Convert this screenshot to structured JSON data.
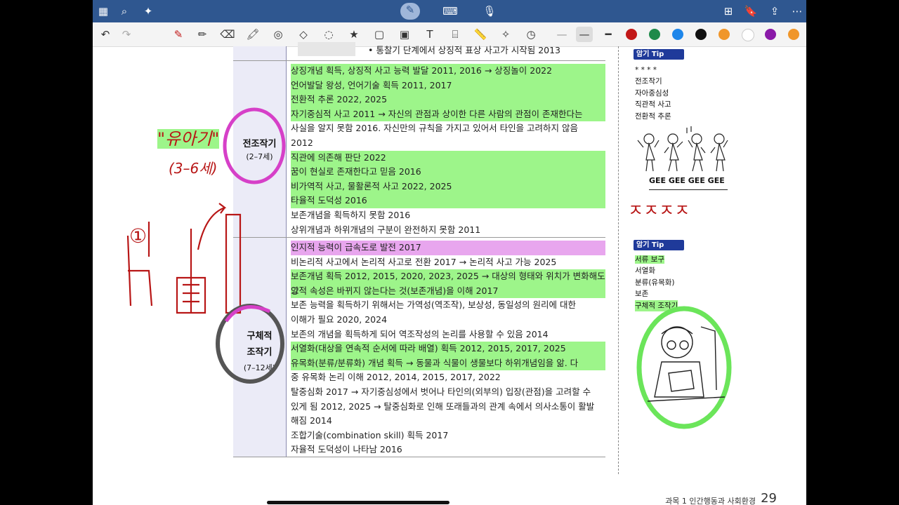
{
  "toolbar_colors": [
    "#c21818",
    "#1e8a4a",
    "#1e86ea",
    "#111111",
    "#f0962a",
    "#ffffff",
    "#8a1aa8",
    "#f0962a"
  ],
  "top": {
    "partial_line": "• 통찰기 단계에서 상징적 표상 사고가 시작됨 2013"
  },
  "stages": {
    "s1": {
      "name": "전조작기",
      "age": "(2–7세)"
    },
    "s2": {
      "name1": "구체적",
      "name2": "조작기",
      "age": "(7–12세)"
    }
  },
  "items1": [
    "상징개념 획득, 상징적 사고 능력 발달 2011, 2016 → 상징놀이 2022",
    "언어발달 왕성, 언어기술 획득 2011, 2017",
    "전환적 추론 2022, 2025",
    "자기중심적 사고 2011 → 자신의 관점과 상이한 다른 사람의 관점이 존재한다는",
    "사실을 알지 못함 2016. 자신만의 규칙을 가지고 있어서 타인을 고려하지 않음",
    "2012",
    "직관에 의존해 판단 2022",
    "꿈이 현실로 존재한다고 믿음 2016",
    "비가역적 사고, 물활론적 사고 2022, 2025",
    "타율적 도덕성 2016",
    "보존개념을 획득하지 못함 2016",
    "상위개념과 하위개념의 구분이 완전하지 못함 2011"
  ],
  "items2": [
    "인지적 능력이 급속도로 발전 2017",
    "비논리적 사고에서 논리적 사고로 전환 2017 → 논리적 사고 가능 2025",
    "보존개념 획득 2012, 2015, 2020, 2023, 2025 → 대상의 형태와 위치가 변화해도 그",
    "양적 속성은 바뀌지 않는다는 것(보존개념)을 이해 2017",
    "보존 능력을 획득하기 위해서는 가역성(역조작), 보상성, 동일성의 원리에 대한",
    "이해가 필요 2020, 2024",
    "보존의 개념을 획득하게 되어 역조작성의 논리를 사용할 수 있음 2014",
    "서열화(대상을 연속적 순서에 따라 배열) 획득 2012, 2015, 2017, 2025",
    "유목화(분류/분류화) 개념 획득 → 동물과 식물이 생물보다 하위개념임을 앎. 다",
    "중 유목화 논리 이해 2012, 2014, 2015, 2017, 2022",
    "탈중심화 2017 → 자기중심성에서 벗어나 타인의(외부의) 입장(관점)을 고려할 수",
    "있게 됨 2012, 2025 → 탈중심화로 인해 또래들과의 관계 속에서 의사소통이 활발",
    "해짐 2014",
    "조합기술(combination skill) 획득 2017",
    "자율적 도덕성이 나타남 2016"
  ],
  "tip1": {
    "label": "암기 Tip",
    "stars": "* * * *",
    "lines": [
      "전조작기",
      "자아중심성",
      "직관적 사고",
      "전환적 추론"
    ],
    "caption": "GEE GEE GEE GEE"
  },
  "tip2": {
    "label": "암기 Tip",
    "head": "서류 보구",
    "lines": [
      "서열화",
      "분류(유목화)",
      "보존",
      "구체적 조작기"
    ]
  },
  "handwriting": {
    "yuagi": "\"유아기\"",
    "age": "(3–6세)",
    "marks": "ㅈㅈㅈㅈ",
    "num": "①"
  },
  "footer": {
    "text": "과목 1 인간행동과 사회환경",
    "page": "29"
  }
}
